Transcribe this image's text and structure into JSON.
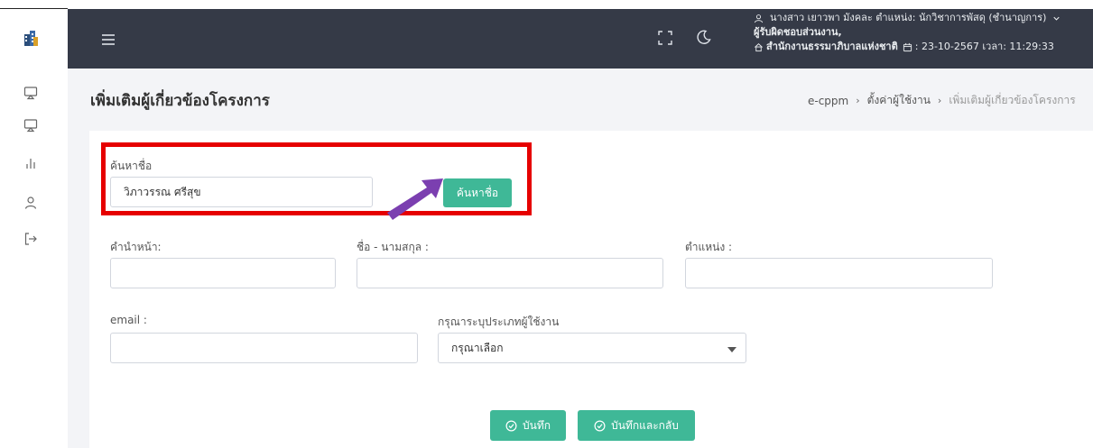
{
  "header": {
    "user_line": "นางสาว เยาวพา มังคละ ตำแหน่ง: นักวิชาการพัสดุ (ชำนาญการ)",
    "role_line": "ผู้รับผิดชอบส่วนงาน,",
    "org_line": "สำนักงานธรรมาภิบาลแห่งชาติ",
    "datetime": ": 23-10-2567 เวลา: 11:29:33"
  },
  "page": {
    "title": "เพิ่มเติมผู้เกี่ยวข้องโครงการ",
    "breadcrumb": [
      "e-cppm",
      "ตั้งค่าผู้ใช้งาน",
      "เพิ่มเติมผู้เกี่ยวข้องโครงการ"
    ]
  },
  "search": {
    "label": "ค้นหาชื่อ",
    "value": "วิภาวรรณ ศรีสุข",
    "button": "ค้นหาชื่อ"
  },
  "form": {
    "prefix_label": "คำนำหน้า:",
    "fullname_label": "ชื่อ - นามสกุล :",
    "position_label": "ตำแหน่ง :",
    "email_label": "email :",
    "usertype_label": "กรุณาระบุประเภทผู้ใช้งาน",
    "usertype_selected": "กรุณาเลือก"
  },
  "actions": {
    "save": "บันทึก",
    "save_back": "บันทึกและกลับ"
  },
  "colors": {
    "header_bg": "#353a47",
    "accent_green": "#3fb897",
    "highlight_red": "#e60000",
    "arrow_purple": "#7b3fb0"
  }
}
